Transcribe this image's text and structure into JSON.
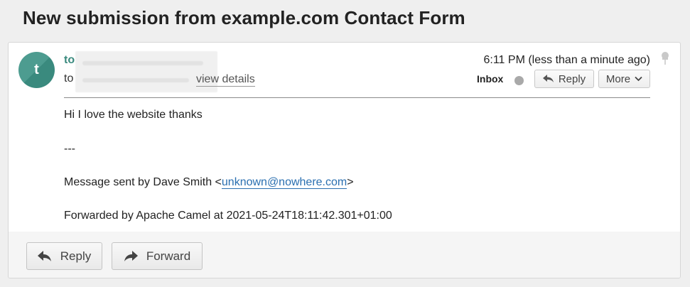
{
  "subject": "New submission from example.com Contact Form",
  "message": {
    "avatar_letter": "t",
    "from_prefix": "to",
    "to_prefix": "to",
    "view_details": "view details",
    "timestamp": "6:11 PM (less than a minute ago)",
    "folder": "Inbox",
    "reply_label": "Reply",
    "more_label": "More",
    "body": {
      "line1": "Hi I love the website thanks",
      "separator": "---",
      "sent_by_prefix": "Message sent by Dave Smith <",
      "sent_by_email": "unknown@nowhere.com",
      "sent_by_suffix": ">",
      "forwarded": "Forwarded by Apache Camel at 2021-05-24T18:11:42.301+01:00"
    }
  },
  "footer": {
    "reply_label": "Reply",
    "forward_label": "Forward"
  },
  "colors": {
    "avatar": "#4d9c90",
    "sender": "#3a8a7e",
    "link": "#2a6fb0"
  }
}
